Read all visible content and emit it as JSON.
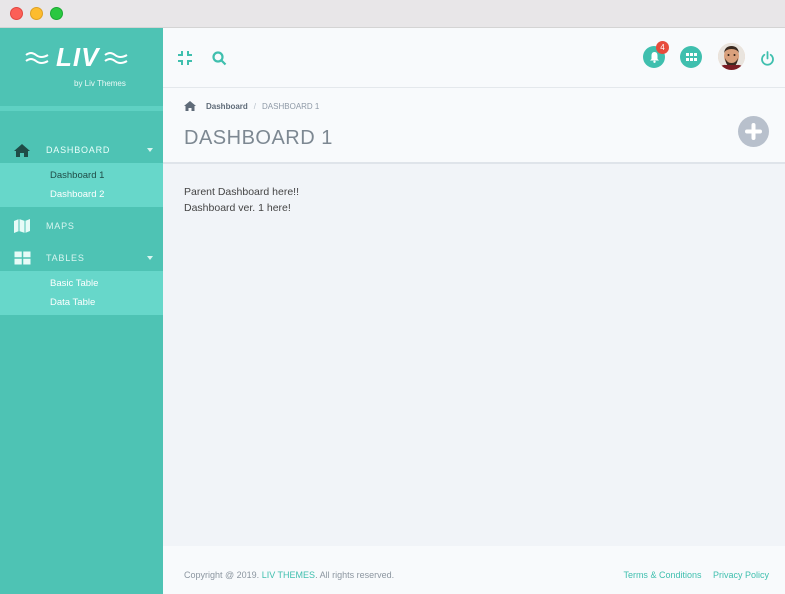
{
  "window": {
    "buttons": [
      "close",
      "minimize",
      "maximize"
    ]
  },
  "sidebar": {
    "brand": {
      "logo": "LIV",
      "subtitle": "by Liv Themes"
    },
    "items": [
      {
        "label": "DASHBOARD",
        "icon": "home-icon",
        "expanded": true,
        "children": [
          {
            "label": "Dashboard 1"
          },
          {
            "label": "Dashboard 2"
          }
        ]
      },
      {
        "label": "MAPS",
        "icon": "map-icon"
      },
      {
        "label": "TABLES",
        "icon": "table-icon",
        "expanded": true,
        "children": [
          {
            "label": "Basic Table"
          },
          {
            "label": "Data Table"
          }
        ]
      }
    ]
  },
  "topbar": {
    "notifications_count": "4",
    "icons": [
      "compress-icon",
      "search-icon",
      "bell-icon",
      "apps-grid-icon",
      "avatar",
      "power-icon"
    ]
  },
  "page": {
    "breadcrumb": {
      "home": "Dashboard",
      "current": "DASHBOARD 1"
    },
    "title": "DASHBOARD 1",
    "content": [
      "Parent Dashboard here!!",
      "Dashboard ver. 1 here!"
    ]
  },
  "footer": {
    "copyright_prefix": "Copyright @ 2019.",
    "copyright_brand": "LIV THEMES",
    "copyright_suffix": ". All rights reserved.",
    "terms": "Terms & Conditions",
    "privacy": "Privacy Policy"
  },
  "colors": {
    "sidebar": "#4ec3b4",
    "submenu": "#67d7ca",
    "accent": "#3fbfae",
    "badge": "#e74c3c"
  }
}
